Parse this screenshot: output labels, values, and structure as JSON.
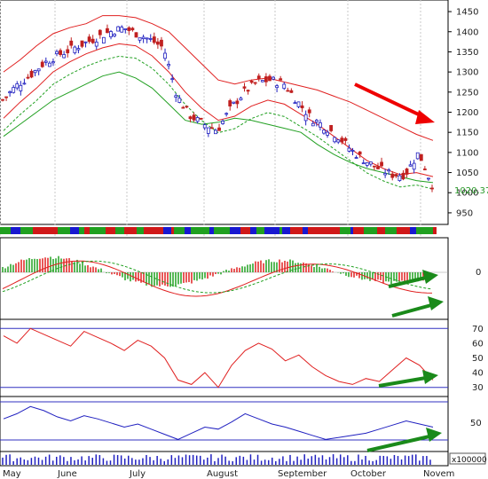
{
  "chart_data": [
    {
      "panel": "price",
      "type": "candlestick",
      "y_ticks": [
        950,
        1000,
        1050,
        1100,
        1150,
        1200,
        1250,
        1300,
        1350,
        1400,
        1450
      ],
      "ylim": [
        930,
        1470
      ],
      "last_value_label": "1020.370",
      "x_labels": [
        "May",
        "June",
        "July",
        "August",
        "September",
        "October",
        "Novem"
      ],
      "series": [
        {
          "name": "",
          "style": "candles",
          "approx_close": [
            1230,
            1265,
            1290,
            1320,
            1340,
            1355,
            1370,
            1385,
            1400,
            1410,
            1395,
            1380,
            1360,
            1240,
            1190,
            1170,
            1155,
            1210,
            1250,
            1275,
            1280,
            1270,
            1225,
            1185,
            1165,
            1140,
            1105,
            1080,
            1060,
            1045,
            1045,
            1100,
            1020
          ]
        },
        {
          "name": "",
          "color": "#e02020",
          "approx": [
            1300,
            1330,
            1365,
            1395,
            1410,
            1420,
            1440,
            1440,
            1435,
            1420,
            1400,
            1360,
            1320,
            1280,
            1270,
            1280,
            1285,
            1275,
            1265,
            1255,
            1240,
            1225,
            1205,
            1185,
            1165,
            1145,
            1130
          ]
        },
        {
          "name": "",
          "color": "#e02020",
          "approx": [
            1185,
            1225,
            1260,
            1300,
            1325,
            1345,
            1360,
            1370,
            1365,
            1340,
            1300,
            1250,
            1210,
            1180,
            1190,
            1215,
            1230,
            1220,
            1195,
            1170,
            1140,
            1110,
            1080,
            1060,
            1045,
            1050,
            1040
          ]
        },
        {
          "name": "",
          "color": "#22a022",
          "approx": [
            1140,
            1170,
            1200,
            1230,
            1250,
            1270,
            1290,
            1300,
            1285,
            1260,
            1220,
            1180,
            1170,
            1175,
            1185,
            1180,
            1170,
            1160,
            1150,
            1120,
            1095,
            1075,
            1060,
            1050,
            1040,
            1030,
            1025
          ]
        }
      ]
    },
    {
      "panel": "indicator-macd",
      "type": "histogram-line",
      "y_ticks": [
        0
      ]
    },
    {
      "panel": "indicator-1",
      "type": "line",
      "y_ticks": [
        30,
        40,
        50,
        60,
        70
      ],
      "ylim": [
        25,
        75
      ],
      "color": "#e02020",
      "approx_values": [
        65,
        60,
        70,
        66,
        62,
        58,
        68,
        64,
        60,
        55,
        62,
        58,
        50,
        35,
        32,
        40,
        30,
        45,
        55,
        60,
        56,
        48,
        52,
        44,
        38,
        34,
        32,
        36,
        34,
        42,
        50,
        45,
        35
      ]
    },
    {
      "panel": "indicator-2",
      "type": "line",
      "y_ticks": [
        50
      ],
      "color": "#2020c0",
      "approx_values": [
        60,
        65,
        72,
        68,
        62,
        58,
        63,
        60,
        56,
        52,
        55,
        50,
        45,
        40,
        46,
        52,
        50,
        57,
        65,
        60,
        55,
        52,
        48,
        44,
        40,
        42,
        44,
        46,
        50,
        54,
        58,
        55,
        52
      ]
    },
    {
      "panel": "volume",
      "type": "bar",
      "unit_label": "x100000"
    }
  ]
}
